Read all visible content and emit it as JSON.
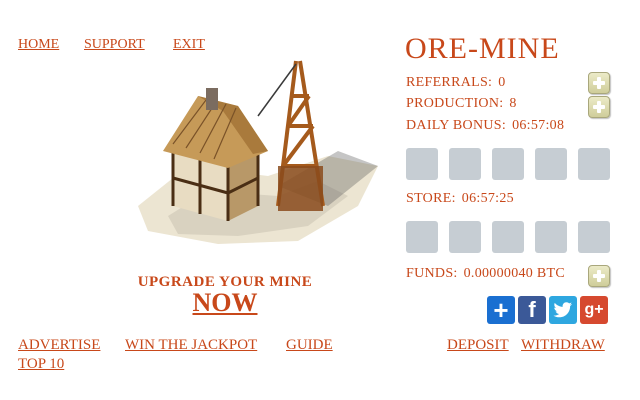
{
  "nav": {
    "home": "HOME",
    "support": "SUPPORT",
    "exit": "EXIT"
  },
  "brand": "ORE-MINE",
  "stats": {
    "referrals_label": "REFERRALS:",
    "referrals_value": "0",
    "production_label": "PRODUCTION:",
    "production_value": "8",
    "daily_bonus_label": "DAILY BONUS:",
    "daily_bonus_value": "06:57:08",
    "store_label": "STORE:",
    "store_value": "06:57:25",
    "funds_label": "FUNDS:",
    "funds_value": "0.00000040 BTC"
  },
  "upgrade": {
    "label": "UPGRADE YOUR MINE",
    "now": "NOW"
  },
  "bottom_nav": {
    "advertise": "ADVERTISE",
    "jackpot": "WIN THE JACKPOT",
    "guide": "GUIDE",
    "top10": "TOP 10",
    "deposit": "DEPOSIT",
    "withdraw": "WITHDRAW"
  },
  "icons": {
    "plus": "plus-icon",
    "facebook": "facebook-icon",
    "twitter": "twitter-icon",
    "google_plus": "google-plus-icon",
    "share": "share-plus-icon"
  },
  "colors": {
    "accent": "#c8481a",
    "slot": "#c6cdd3",
    "facebook": "#3b5998",
    "twitter": "#2ea7e0",
    "google": "#d6492f",
    "share": "#1a6fd1"
  }
}
